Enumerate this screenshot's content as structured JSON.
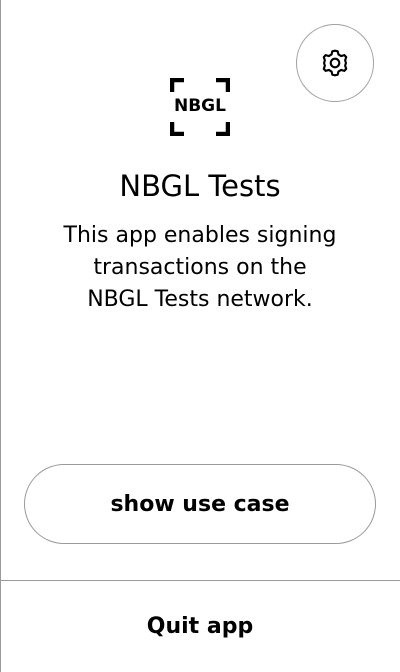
{
  "settings": {
    "icon": "gear-icon"
  },
  "app": {
    "icon_text": "NBGL",
    "title": "NBGL Tests",
    "description_lines": [
      "This app enables signing",
      "transactions on the",
      "NBGL Tests network."
    ]
  },
  "actions": {
    "use_case_label": "show use case",
    "quit_label": "Quit app"
  }
}
